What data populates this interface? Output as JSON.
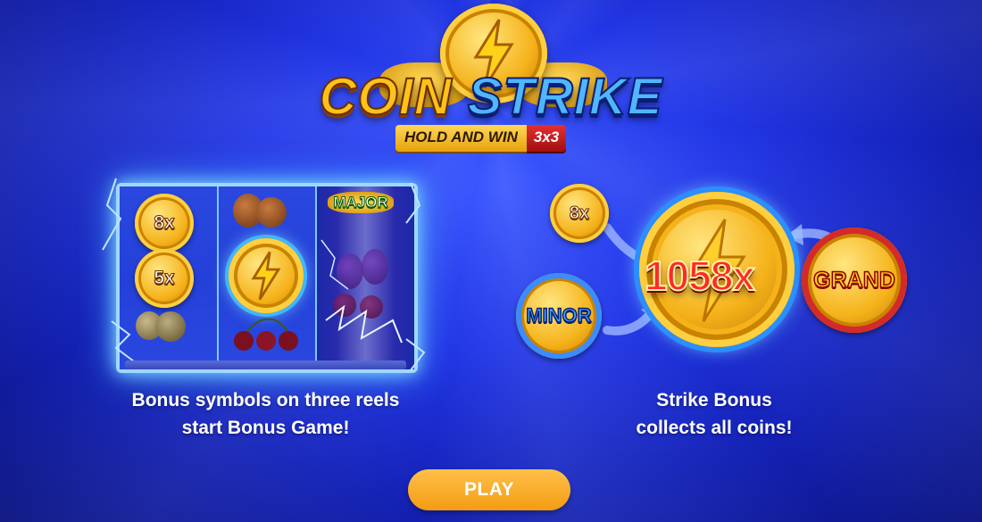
{
  "logo": {
    "word1": "COIN",
    "word2": "STRIKE",
    "subtitle": "HOLD AND WIN",
    "grid": "3x3"
  },
  "reels": {
    "reel1_coins": [
      "8x",
      "5x"
    ],
    "reel3_label": "MAJOR"
  },
  "captions": {
    "left_line1": "Bonus symbols on three reels",
    "left_line2": "start Bonus Game!",
    "right_line1": "Strike Bonus",
    "right_line2": "collects all coins!"
  },
  "illustration": {
    "big_value": "1058x",
    "coin_8x": "8x",
    "coin_minor": "MINOR",
    "coin_grand": "GRAND"
  },
  "play_button": {
    "label": "PLAY"
  },
  "colors": {
    "background": "#2236e6",
    "gold": "#f5b21a",
    "electric_blue": "#7fd0ff",
    "play_button": "#f39c12",
    "value_red": "#ff2a2a"
  },
  "icons": [
    "lightning-bolt-icon",
    "fruit-orange-icon",
    "fruit-lemon-icon",
    "cherry-icon",
    "plum-icon",
    "arrow-icon"
  ]
}
